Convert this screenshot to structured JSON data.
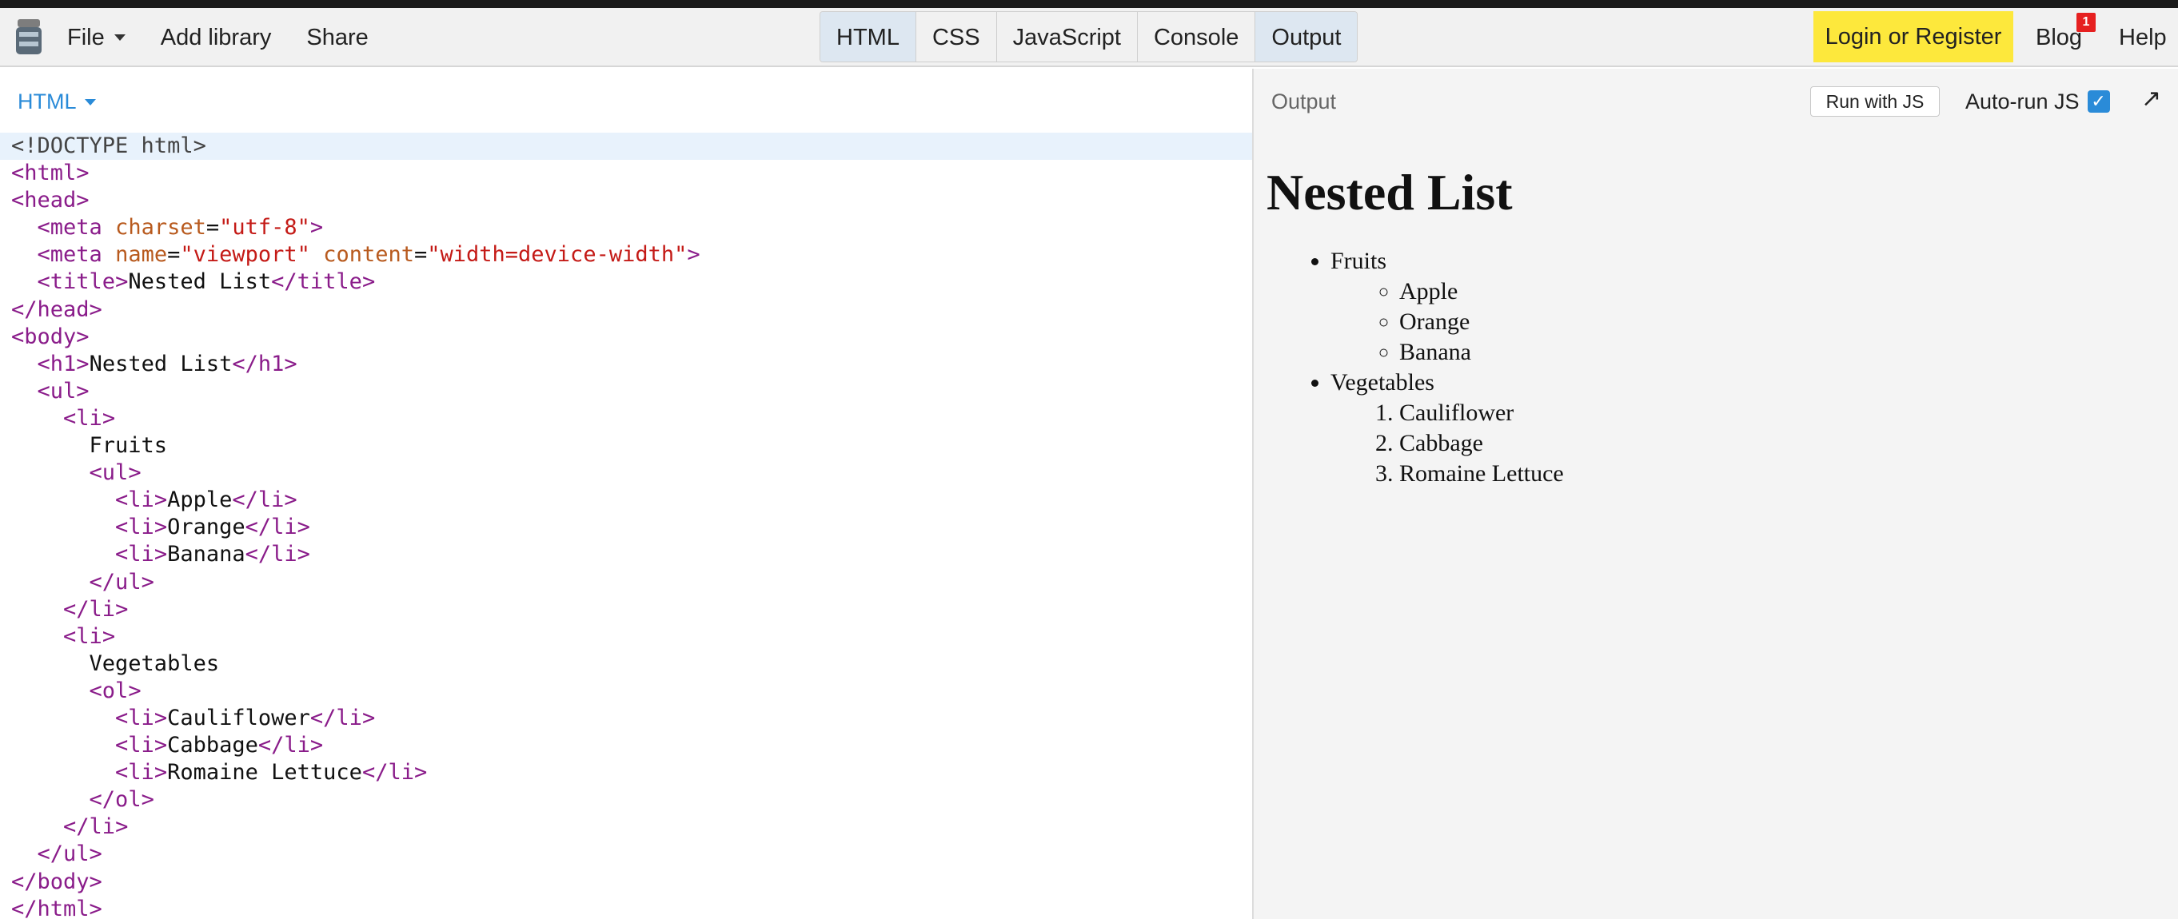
{
  "nav": {
    "file": "File",
    "add_library": "Add library",
    "share": "Share",
    "tabs": [
      "HTML",
      "CSS",
      "JavaScript",
      "Console",
      "Output"
    ],
    "login": "Login or Register",
    "blog": "Blog",
    "blog_badge": "1",
    "help": "Help"
  },
  "editor": {
    "label": "HTML",
    "lines": [
      "<!DOCTYPE html>",
      "<html>",
      "<head>",
      "  <meta charset=\"utf-8\">",
      "  <meta name=\"viewport\" content=\"width=device-width\">",
      "  <title>Nested List</title>",
      "</head>",
      "<body>",
      "  <h1>Nested List</h1>",
      "  <ul>",
      "    <li>",
      "      Fruits",
      "      <ul>",
      "        <li>Apple</li>",
      "        <li>Orange</li>",
      "        <li>Banana</li>",
      "      </ul>",
      "    </li>",
      "    <li>",
      "      Vegetables",
      "      <ol>",
      "        <li>Cauliflower</li>",
      "        <li>Cabbage</li>",
      "        <li>Romaine Lettuce</li>",
      "      </ol>",
      "    </li>",
      "  </ul>",
      "</body>",
      "</html>"
    ]
  },
  "output": {
    "label": "Output",
    "run_button": "Run with JS",
    "autorun_label": "Auto-run JS",
    "autorun_checked": true,
    "page": {
      "heading": "Nested List",
      "fruits_label": "Fruits",
      "fruits": [
        "Apple",
        "Orange",
        "Banana"
      ],
      "vegetables_label": "Vegetables",
      "vegetables": [
        "Cauliflower",
        "Cabbage",
        "Romaine Lettuce"
      ]
    }
  },
  "colors": {
    "accent": "#2a8bd8",
    "login_bg": "#fde83c",
    "tag": "#8a1c8a",
    "attr_name": "#b85a1e",
    "attr_value": "#c41a16"
  }
}
